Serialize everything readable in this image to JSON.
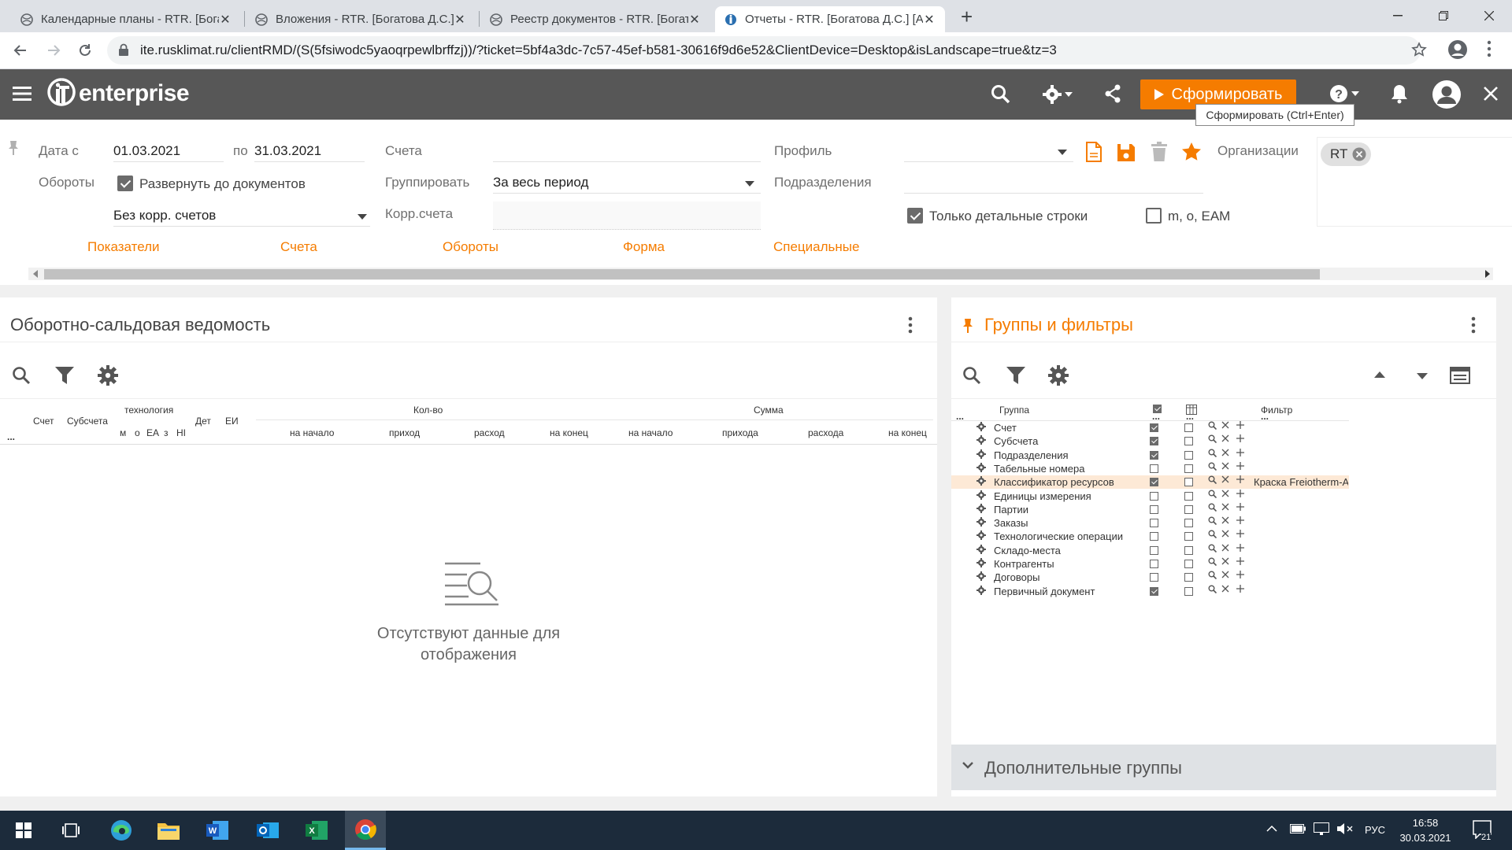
{
  "browser": {
    "tabs": [
      {
        "label": "Календарные планы - RTR. [Бога",
        "close": "✕"
      },
      {
        "label": "Вложения - RTR. [Богатова Д.С.]",
        "close": "✕"
      },
      {
        "label": "Реестр документов - RTR. [Богат",
        "close": "✕"
      },
      {
        "label": "Отчеты - RTR. [Богатова Д.С.] [А",
        "close": "✕"
      }
    ],
    "new_tab": "+",
    "url": "ite.rusklimat.ru/clientRMD/(S(5fsiwodc5yaoqrpewlbrffzj))/?ticket=5bf4a3dc-7c57-45ef-b581-30616f9d6e52&ClientDevice=Desktop&isLandscape=true&tz=3"
  },
  "app": {
    "logo_text": "enterprise",
    "run_button": "Сформировать",
    "run_tooltip": "Сформировать (Ctrl+Enter)",
    "accent_color": "#f57c00"
  },
  "params": {
    "date_from_label": "Дата с",
    "date_from": "01.03.2021",
    "date_to_label": "по",
    "date_to": "31.03.2021",
    "turnover_label": "Обороты",
    "expand_docs": "Развернуть до документов",
    "expand_docs_checked": true,
    "corr_select": "Без корр. счетов",
    "accounts_label": "Счета",
    "group_label": "Группировать",
    "group_value": "За весь период",
    "corr_accounts_label": "Корр.счета",
    "profile_label": "Профиль",
    "divisions_label": "Подразделения",
    "detail_only": "Только детальные строки",
    "detail_only_checked": true,
    "meo": "m, o, EAM",
    "meo_checked": false,
    "org_label": "Организации",
    "org_chip": "RT",
    "links": [
      "Показатели",
      "Счета",
      "Обороты",
      "Форма",
      "Специальные"
    ]
  },
  "left_panel": {
    "title": "Оборотно-сальдовая ведомость",
    "col_account": "Счет",
    "col_subaccount": "Субсчета",
    "col_tech": "технология",
    "tech_sub": [
      "м",
      "о",
      "ЕА",
      "з",
      "НІ"
    ],
    "col_det": "Дет",
    "col_unit": "ЕИ",
    "group_qty": "Кол-во",
    "group_sum": "Сумма",
    "qty_cols": [
      "на начало",
      "приход",
      "расход",
      "на конец"
    ],
    "sum_cols": [
      "на начало",
      "прихода",
      "расхода",
      "на конец"
    ],
    "ellipsis": "...",
    "empty_text_1": "Отсутствуют данные для",
    "empty_text_2": "отображения"
  },
  "right_panel": {
    "title": "Группы и фильтры",
    "col_group": "Группа",
    "col_filter": "Фильтр",
    "ellipsis": "...",
    "rows": [
      {
        "name": "Счет",
        "checked": true,
        "filter": ""
      },
      {
        "name": "Субсчета",
        "checked": true,
        "filter": ""
      },
      {
        "name": "Подразделения",
        "checked": true,
        "filter": ""
      },
      {
        "name": "Табельные номера",
        "checked": false,
        "filter": ""
      },
      {
        "name": "Классификатор ресурсов",
        "checked": true,
        "filter": "Краска Freiotherm-A"
      },
      {
        "name": "Единицы измерения",
        "checked": false,
        "filter": ""
      },
      {
        "name": "Партии",
        "checked": false,
        "filter": ""
      },
      {
        "name": "Заказы",
        "checked": false,
        "filter": ""
      },
      {
        "name": "Технологические операции",
        "checked": false,
        "filter": ""
      },
      {
        "name": "Складо-места",
        "checked": false,
        "filter": ""
      },
      {
        "name": "Контрагенты",
        "checked": false,
        "filter": ""
      },
      {
        "name": "Договоры",
        "checked": false,
        "filter": ""
      },
      {
        "name": "Первичный документ",
        "checked": true,
        "filter": ""
      }
    ],
    "extra_groups": "Дополнительные группы"
  },
  "taskbar": {
    "lang": "РУС",
    "time": "16:58",
    "date": "30.03.2021",
    "notif_count": "21"
  }
}
